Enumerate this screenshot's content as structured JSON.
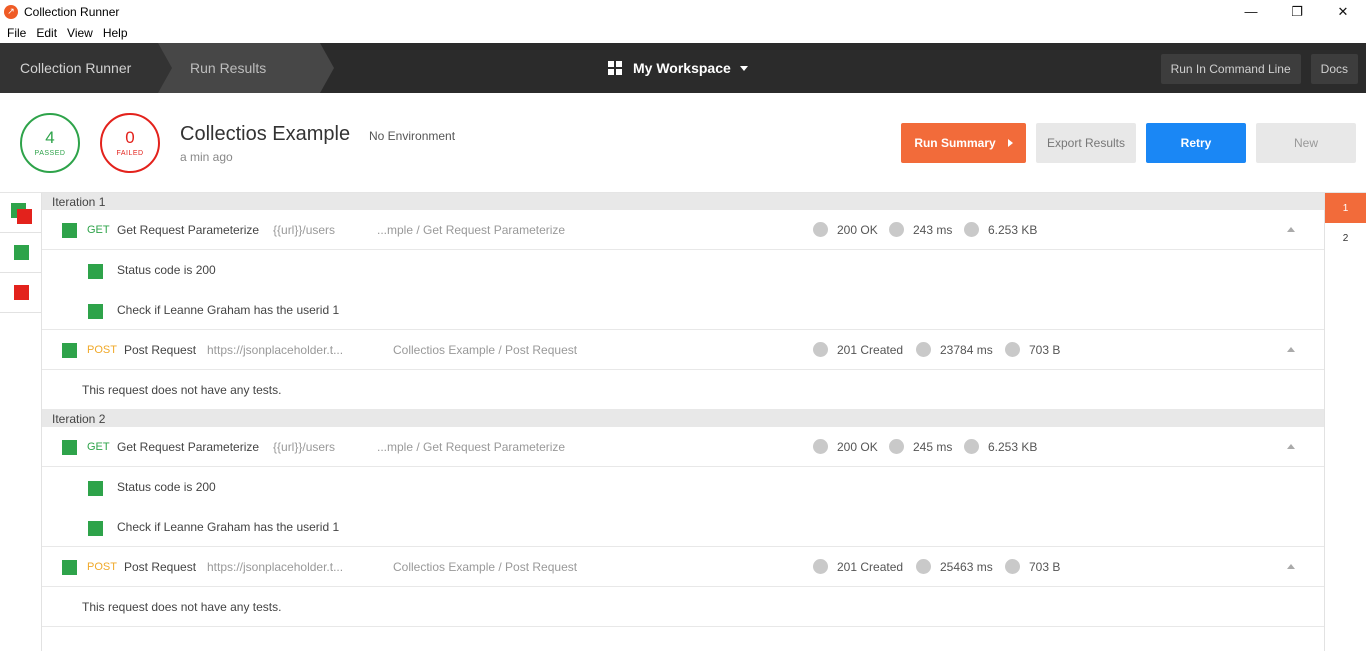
{
  "window": {
    "title": "Collection Runner"
  },
  "menu": [
    "File",
    "Edit",
    "View",
    "Help"
  ],
  "header": {
    "crumbs": [
      "Collection Runner",
      "Run Results"
    ],
    "workspace": "My Workspace",
    "buttons": {
      "run_cli": "Run In Command Line",
      "docs": "Docs"
    }
  },
  "summary": {
    "passed_count": "4",
    "passed_label": "PASSED",
    "failed_count": "0",
    "failed_label": "FAILED",
    "collection": "Collectios Example",
    "environment": "No Environment",
    "time_ago": "a min ago",
    "buttons": {
      "run_summary": "Run Summary",
      "export": "Export Results",
      "retry": "Retry",
      "new": "New"
    }
  },
  "colors": {
    "accent": "#f26b3a",
    "pass": "#2ea34a",
    "fail": "#e3221c",
    "primary": "#1a87f5"
  },
  "iteration_tabs": [
    "1",
    "2"
  ],
  "iterations": [
    {
      "label": "Iteration 1",
      "requests": [
        {
          "method": "GET",
          "name": "Get Request Parameterize",
          "url": "{{url}}/users",
          "path": "...mple / Get Request Parameterize",
          "status": "200 OK",
          "time": "243 ms",
          "size": "6.253 KB",
          "tests": [
            "Status code is 200",
            "Check if Leanne Graham has the userid 1"
          ]
        },
        {
          "method": "POST",
          "name": "Post Request",
          "url": "https://jsonplaceholder.t...",
          "path": "Collectios Example / Post Request",
          "status": "201 Created",
          "time": "23784 ms",
          "size": "703 B",
          "no_tests": "This request does not have any tests."
        }
      ]
    },
    {
      "label": "Iteration 2",
      "requests": [
        {
          "method": "GET",
          "name": "Get Request Parameterize",
          "url": "{{url}}/users",
          "path": "...mple / Get Request Parameterize",
          "status": "200 OK",
          "time": "245 ms",
          "size": "6.253 KB",
          "tests": [
            "Status code is 200",
            "Check if Leanne Graham has the userid 1"
          ]
        },
        {
          "method": "POST",
          "name": "Post Request",
          "url": "https://jsonplaceholder.t...",
          "path": "Collectios Example / Post Request",
          "status": "201 Created",
          "time": "25463 ms",
          "size": "703 B",
          "no_tests": "This request does not have any tests."
        }
      ]
    }
  ]
}
